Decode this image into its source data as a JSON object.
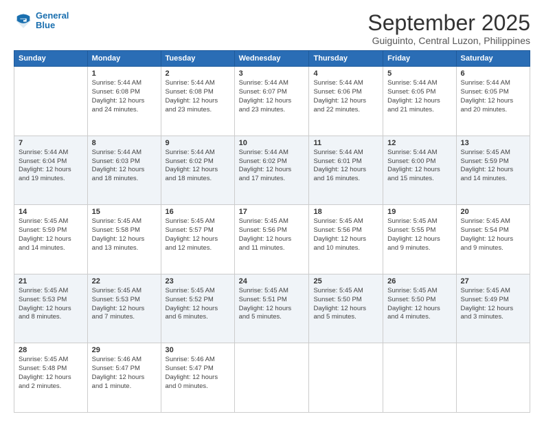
{
  "logo": {
    "line1": "General",
    "line2": "Blue"
  },
  "title": "September 2025",
  "subtitle": "Guiguinto, Central Luzon, Philippines",
  "weekdays": [
    "Sunday",
    "Monday",
    "Tuesday",
    "Wednesday",
    "Thursday",
    "Friday",
    "Saturday"
  ],
  "weeks": [
    [
      {
        "day": "",
        "info": ""
      },
      {
        "day": "1",
        "info": "Sunrise: 5:44 AM\nSunset: 6:08 PM\nDaylight: 12 hours\nand 24 minutes."
      },
      {
        "day": "2",
        "info": "Sunrise: 5:44 AM\nSunset: 6:08 PM\nDaylight: 12 hours\nand 23 minutes."
      },
      {
        "day": "3",
        "info": "Sunrise: 5:44 AM\nSunset: 6:07 PM\nDaylight: 12 hours\nand 23 minutes."
      },
      {
        "day": "4",
        "info": "Sunrise: 5:44 AM\nSunset: 6:06 PM\nDaylight: 12 hours\nand 22 minutes."
      },
      {
        "day": "5",
        "info": "Sunrise: 5:44 AM\nSunset: 6:05 PM\nDaylight: 12 hours\nand 21 minutes."
      },
      {
        "day": "6",
        "info": "Sunrise: 5:44 AM\nSunset: 6:05 PM\nDaylight: 12 hours\nand 20 minutes."
      }
    ],
    [
      {
        "day": "7",
        "info": "Sunrise: 5:44 AM\nSunset: 6:04 PM\nDaylight: 12 hours\nand 19 minutes."
      },
      {
        "day": "8",
        "info": "Sunrise: 5:44 AM\nSunset: 6:03 PM\nDaylight: 12 hours\nand 18 minutes."
      },
      {
        "day": "9",
        "info": "Sunrise: 5:44 AM\nSunset: 6:02 PM\nDaylight: 12 hours\nand 18 minutes."
      },
      {
        "day": "10",
        "info": "Sunrise: 5:44 AM\nSunset: 6:02 PM\nDaylight: 12 hours\nand 17 minutes."
      },
      {
        "day": "11",
        "info": "Sunrise: 5:44 AM\nSunset: 6:01 PM\nDaylight: 12 hours\nand 16 minutes."
      },
      {
        "day": "12",
        "info": "Sunrise: 5:44 AM\nSunset: 6:00 PM\nDaylight: 12 hours\nand 15 minutes."
      },
      {
        "day": "13",
        "info": "Sunrise: 5:45 AM\nSunset: 5:59 PM\nDaylight: 12 hours\nand 14 minutes."
      }
    ],
    [
      {
        "day": "14",
        "info": "Sunrise: 5:45 AM\nSunset: 5:59 PM\nDaylight: 12 hours\nand 14 minutes."
      },
      {
        "day": "15",
        "info": "Sunrise: 5:45 AM\nSunset: 5:58 PM\nDaylight: 12 hours\nand 13 minutes."
      },
      {
        "day": "16",
        "info": "Sunrise: 5:45 AM\nSunset: 5:57 PM\nDaylight: 12 hours\nand 12 minutes."
      },
      {
        "day": "17",
        "info": "Sunrise: 5:45 AM\nSunset: 5:56 PM\nDaylight: 12 hours\nand 11 minutes."
      },
      {
        "day": "18",
        "info": "Sunrise: 5:45 AM\nSunset: 5:56 PM\nDaylight: 12 hours\nand 10 minutes."
      },
      {
        "day": "19",
        "info": "Sunrise: 5:45 AM\nSunset: 5:55 PM\nDaylight: 12 hours\nand 9 minutes."
      },
      {
        "day": "20",
        "info": "Sunrise: 5:45 AM\nSunset: 5:54 PM\nDaylight: 12 hours\nand 9 minutes."
      }
    ],
    [
      {
        "day": "21",
        "info": "Sunrise: 5:45 AM\nSunset: 5:53 PM\nDaylight: 12 hours\nand 8 minutes."
      },
      {
        "day": "22",
        "info": "Sunrise: 5:45 AM\nSunset: 5:53 PM\nDaylight: 12 hours\nand 7 minutes."
      },
      {
        "day": "23",
        "info": "Sunrise: 5:45 AM\nSunset: 5:52 PM\nDaylight: 12 hours\nand 6 minutes."
      },
      {
        "day": "24",
        "info": "Sunrise: 5:45 AM\nSunset: 5:51 PM\nDaylight: 12 hours\nand 5 minutes."
      },
      {
        "day": "25",
        "info": "Sunrise: 5:45 AM\nSunset: 5:50 PM\nDaylight: 12 hours\nand 5 minutes."
      },
      {
        "day": "26",
        "info": "Sunrise: 5:45 AM\nSunset: 5:50 PM\nDaylight: 12 hours\nand 4 minutes."
      },
      {
        "day": "27",
        "info": "Sunrise: 5:45 AM\nSunset: 5:49 PM\nDaylight: 12 hours\nand 3 minutes."
      }
    ],
    [
      {
        "day": "28",
        "info": "Sunrise: 5:45 AM\nSunset: 5:48 PM\nDaylight: 12 hours\nand 2 minutes."
      },
      {
        "day": "29",
        "info": "Sunrise: 5:46 AM\nSunset: 5:47 PM\nDaylight: 12 hours\nand 1 minute."
      },
      {
        "day": "30",
        "info": "Sunrise: 5:46 AM\nSunset: 5:47 PM\nDaylight: 12 hours\nand 0 minutes."
      },
      {
        "day": "",
        "info": ""
      },
      {
        "day": "",
        "info": ""
      },
      {
        "day": "",
        "info": ""
      },
      {
        "day": "",
        "info": ""
      }
    ]
  ]
}
